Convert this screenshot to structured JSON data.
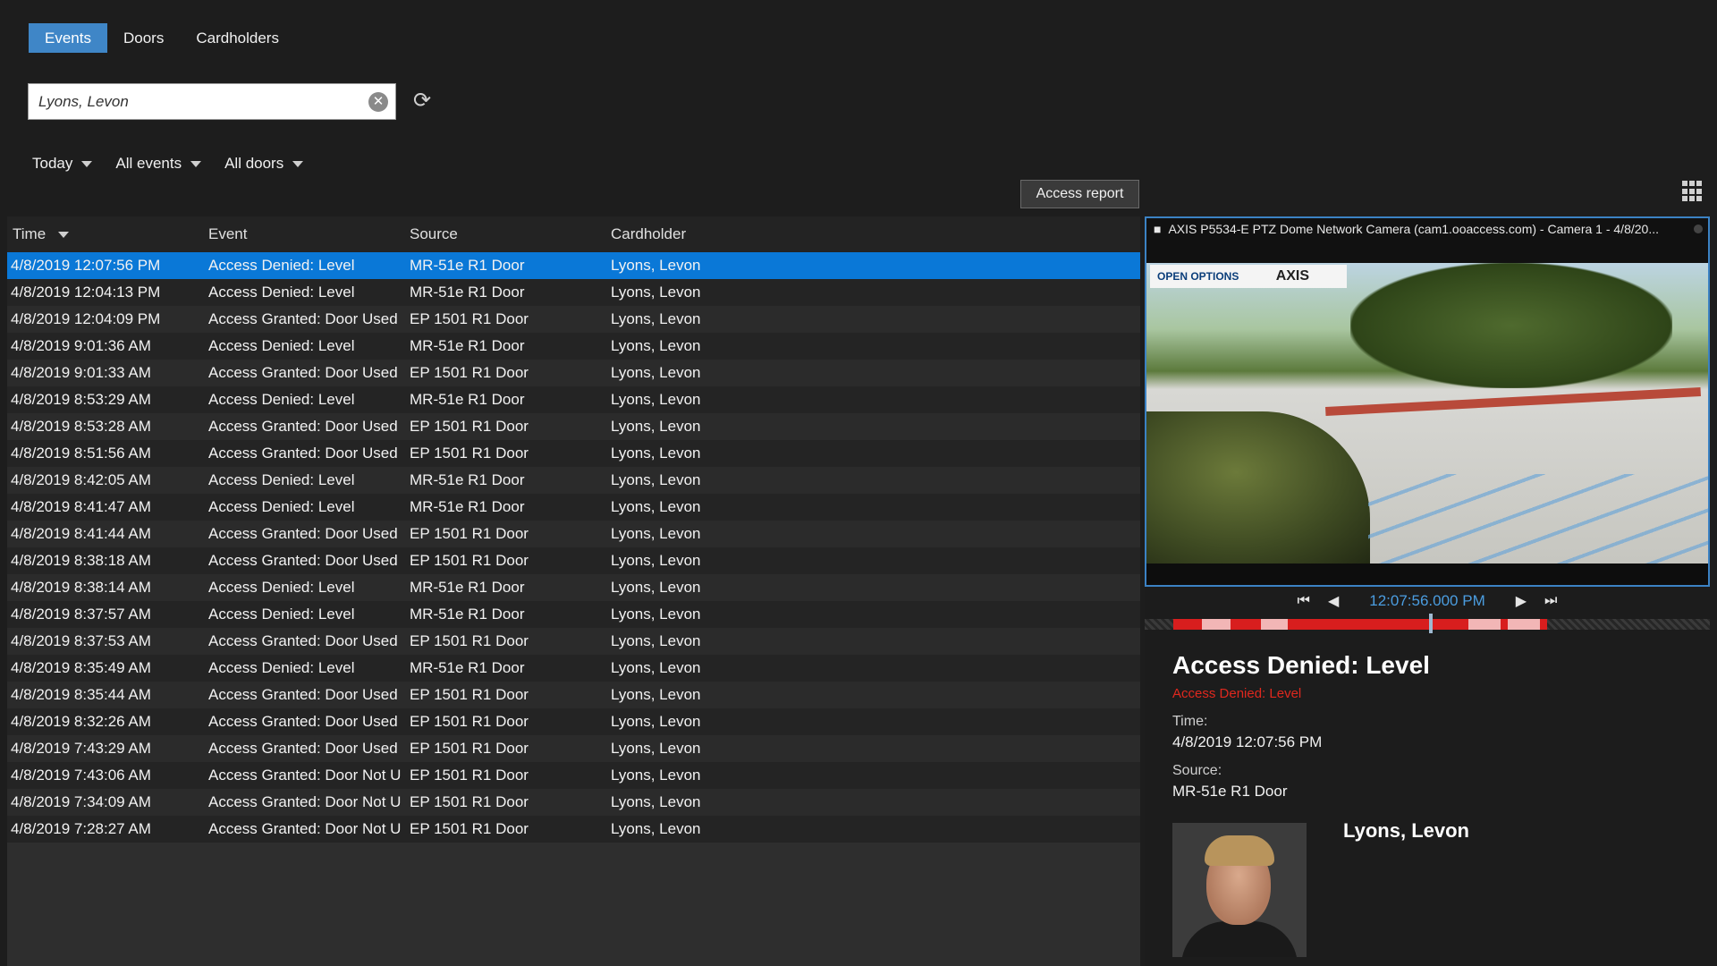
{
  "tabs": [
    {
      "label": "Events",
      "active": true
    },
    {
      "label": "Doors",
      "active": false
    },
    {
      "label": "Cardholders",
      "active": false
    }
  ],
  "search": {
    "value": "Lyons, Levon",
    "clear_icon": "clear-icon",
    "refresh_icon": "refresh-icon"
  },
  "filters": {
    "date": "Today",
    "events": "All events",
    "doors": "All doors"
  },
  "access_report_label": "Access report",
  "table": {
    "headers": {
      "time": "Time",
      "event": "Event",
      "source": "Source",
      "cardholder": "Cardholder"
    },
    "sort_column": "Time",
    "rows": [
      {
        "time": "4/8/2019 12:07:56 PM",
        "event": "Access Denied: Level",
        "source": "MR-51e  R1 Door",
        "cardholder": "Lyons, Levon",
        "selected": true
      },
      {
        "time": "4/8/2019 12:04:13 PM",
        "event": "Access Denied: Level",
        "source": "MR-51e  R1 Door",
        "cardholder": "Lyons, Levon"
      },
      {
        "time": "4/8/2019 12:04:09 PM",
        "event": "Access Granted: Door Used",
        "source": "EP 1501 R1 Door",
        "cardholder": "Lyons, Levon"
      },
      {
        "time": "4/8/2019 9:01:36 AM",
        "event": "Access Denied: Level",
        "source": "MR-51e  R1 Door",
        "cardholder": "Lyons, Levon"
      },
      {
        "time": "4/8/2019 9:01:33 AM",
        "event": "Access Granted: Door Used",
        "source": "EP 1501 R1 Door",
        "cardholder": "Lyons, Levon"
      },
      {
        "time": "4/8/2019 8:53:29 AM",
        "event": "Access Denied: Level",
        "source": "MR-51e  R1 Door",
        "cardholder": "Lyons, Levon"
      },
      {
        "time": "4/8/2019 8:53:28 AM",
        "event": "Access Granted: Door Used",
        "source": "EP 1501 R1 Door",
        "cardholder": "Lyons, Levon"
      },
      {
        "time": "4/8/2019 8:51:56 AM",
        "event": "Access Granted: Door Used",
        "source": "EP 1501 R1 Door",
        "cardholder": "Lyons, Levon"
      },
      {
        "time": "4/8/2019 8:42:05 AM",
        "event": "Access Denied: Level",
        "source": "MR-51e  R1 Door",
        "cardholder": "Lyons, Levon"
      },
      {
        "time": "4/8/2019 8:41:47 AM",
        "event": "Access Denied: Level",
        "source": "MR-51e  R1 Door",
        "cardholder": "Lyons, Levon"
      },
      {
        "time": "4/8/2019 8:41:44 AM",
        "event": "Access Granted: Door Used",
        "source": "EP 1501 R1 Door",
        "cardholder": "Lyons, Levon"
      },
      {
        "time": "4/8/2019 8:38:18 AM",
        "event": "Access Granted: Door Used",
        "source": "EP 1501 R1 Door",
        "cardholder": "Lyons, Levon"
      },
      {
        "time": "4/8/2019 8:38:14 AM",
        "event": "Access Denied: Level",
        "source": "MR-51e  R1 Door",
        "cardholder": "Lyons, Levon"
      },
      {
        "time": "4/8/2019 8:37:57 AM",
        "event": "Access Denied: Level",
        "source": "MR-51e  R1 Door",
        "cardholder": "Lyons, Levon"
      },
      {
        "time": "4/8/2019 8:37:53 AM",
        "event": "Access Granted: Door Used",
        "source": "EP 1501 R1 Door",
        "cardholder": "Lyons, Levon"
      },
      {
        "time": "4/8/2019 8:35:49 AM",
        "event": "Access Denied: Level",
        "source": "MR-51e  R1 Door",
        "cardholder": "Lyons, Levon"
      },
      {
        "time": "4/8/2019 8:35:44 AM",
        "event": "Access Granted: Door Used",
        "source": "EP 1501 R1 Door",
        "cardholder": "Lyons, Levon"
      },
      {
        "time": "4/8/2019 8:32:26 AM",
        "event": "Access Granted: Door Used",
        "source": "EP 1501 R1 Door",
        "cardholder": "Lyons, Levon"
      },
      {
        "time": "4/8/2019 7:43:29 AM",
        "event": "Access Granted: Door Used",
        "source": "EP 1501 R1 Door",
        "cardholder": "Lyons, Levon"
      },
      {
        "time": "4/8/2019 7:43:06 AM",
        "event": "Access Granted: Door Not U",
        "source": "EP 1501 R1 Door",
        "cardholder": "Lyons, Levon"
      },
      {
        "time": "4/8/2019 7:34:09 AM",
        "event": "Access Granted: Door Not U",
        "source": "EP 1501 R1 Door",
        "cardholder": "Lyons, Levon"
      },
      {
        "time": "4/8/2019 7:28:27 AM",
        "event": "Access Granted: Door Not U",
        "source": "EP 1501 R1 Door",
        "cardholder": "Lyons, Levon"
      }
    ]
  },
  "camera": {
    "title": "AXIS P5534-E PTZ Dome Network Camera (cam1.ooaccess.com) - Camera 1 - 4/8/20...",
    "overlay_brand": "OPEN OPTIONS",
    "overlay_axis": "AXIS"
  },
  "playback": {
    "time": "12:07:56.000 PM",
    "icons": [
      "skip-back-icon",
      "step-back-icon",
      "play-icon",
      "skip-forward-icon"
    ]
  },
  "details": {
    "title": "Access Denied: Level",
    "subtitle": "Access Denied: Level",
    "time_label": "Time:",
    "time_value": "4/8/2019 12:07:56 PM",
    "source_label": "Source:",
    "source_value": "MR-51e  R1 Door",
    "cardholder_name": "Lyons, Levon"
  },
  "colors": {
    "selected_row": "#0a78d7",
    "active_tab": "#3f86c7",
    "alert_text": "#e0281e",
    "timeline_red": "#d81e1e"
  }
}
